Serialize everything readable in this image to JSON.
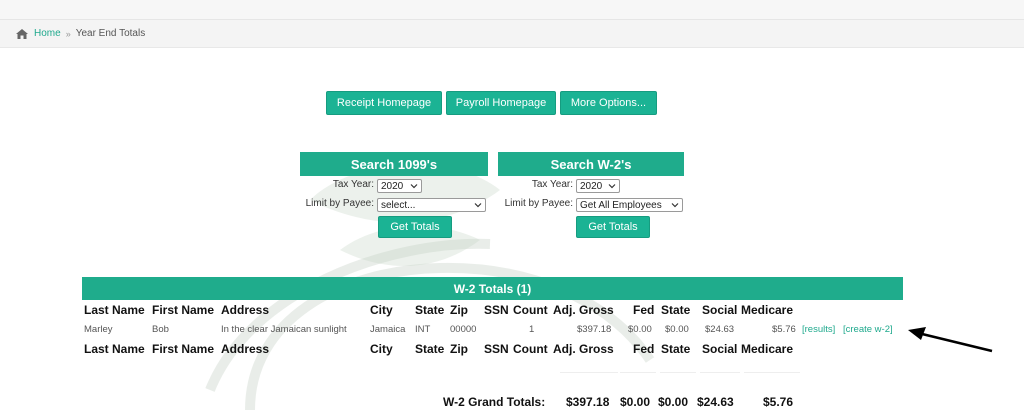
{
  "breadcrumb": {
    "home": "Home",
    "separator": "»",
    "current": "Year End Totals"
  },
  "toolbar": {
    "receipt": "Receipt Homepage",
    "payroll": "Payroll Homepage",
    "more": "More Options..."
  },
  "search_1099": {
    "title": "Search 1099's",
    "tax_year_label": "Tax Year:",
    "tax_year_value": "2020",
    "payee_label": "Limit by Payee:",
    "payee_value": "select...",
    "button": "Get Totals"
  },
  "search_w2": {
    "title": "Search W-2's",
    "tax_year_label": "Tax Year:",
    "tax_year_value": "2020",
    "payee_label": "Limit by Payee:",
    "payee_value": "Get All Employees",
    "button": "Get Totals"
  },
  "w2_totals": {
    "title": "W-2 Totals (1)",
    "columns": [
      "Last Name",
      "First Name",
      "Address",
      "City",
      "State",
      "Zip",
      "SSN",
      "Count",
      "Adj. Gross",
      "Fed",
      "State",
      "Social",
      "Medicare"
    ],
    "rows": [
      {
        "last": "Marley",
        "first": "Bob",
        "address": "In the clear Jamaican sunlight",
        "city": "Jamaica",
        "state": "INT",
        "zip": "00000",
        "ssn": "",
        "count": "1",
        "adj_gross": "$397.18",
        "fed": "$0.00",
        "state_tax": "$0.00",
        "social": "$24.63",
        "medicare": "$5.76",
        "results_link": "[results]",
        "create_link": "[create w-2]"
      }
    ],
    "grand": {
      "label": "W-2 Grand Totals:",
      "adj_gross": "$397.18",
      "fed": "$0.00",
      "state_tax": "$0.00",
      "social": "$24.63",
      "medicare": "$5.76"
    }
  },
  "colors": {
    "accent": "#1fac8c",
    "link": "#1fa98d"
  },
  "icons": [
    "home-icon",
    "chevron-down-icon",
    "arrow-annotation-icon"
  ]
}
